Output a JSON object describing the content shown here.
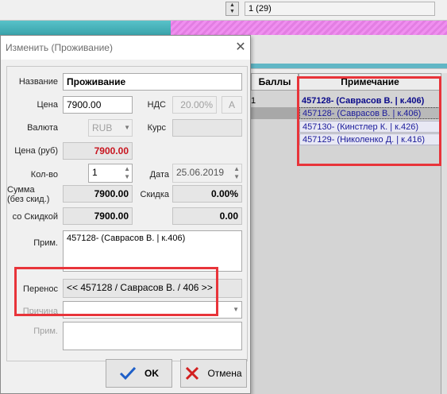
{
  "background": {
    "pager_text": "1 (29)",
    "grid": {
      "headers": [
        "Баллы",
        "Примечание"
      ],
      "rows": [
        {
          "col1": "1",
          "note": "457128- (Саврасов В. | к.406)"
        },
        {
          "col1": "",
          "note": "457128- (Саврасов В. | к.406)"
        },
        {
          "col1": "",
          "note": "457130- (Кинстлер К. | к.426)"
        },
        {
          "col1": "",
          "note": "457129- (Николенко Д. | к.416)"
        }
      ]
    }
  },
  "dialog": {
    "title": "Изменить (Проживание)",
    "fields": {
      "name_label": "Название",
      "name_value": "Проживание",
      "price_label": "Цена",
      "price_value": "7900.00",
      "vat_label": "НДС",
      "vat_value": "20.00%",
      "vat_button": "A",
      "currency_label": "Валюта",
      "currency_value": "RUB",
      "rate_label": "Курс",
      "rate_value": "",
      "price_rub_label": "Цена (руб)",
      "price_rub_value": "7900.00",
      "qty_label": "Кол-во",
      "qty_value": "1",
      "date_label": "Дата",
      "date_value": "25.06.2019",
      "sum_label": "Сумма\n(без скид.)",
      "sum_value": "7900.00",
      "discount_label": "Скидка",
      "discount_value": "0.00%",
      "with_discount_label": "со Скидкой",
      "with_discount_value": "7900.00",
      "with_discount_right": "0.00",
      "note_label": "Прим.",
      "note_value": "457128- (Саврасов В. | к.406)",
      "transfer_label": "Перенос",
      "transfer_value": "<< 457128 / Саврасов В. / 406 >>",
      "reason_label": "Причина",
      "reason_value": "",
      "note2_label": "Прим.",
      "note2_value": ""
    },
    "buttons": {
      "ok": "OK",
      "cancel": "Отмена"
    }
  },
  "colors": {
    "highlight": "#e8343a",
    "ok_check": "#1e5fc8",
    "cancel_x": "#d21f1f",
    "price_rub": "#c8141e",
    "note_text": "#1a1a9a"
  }
}
